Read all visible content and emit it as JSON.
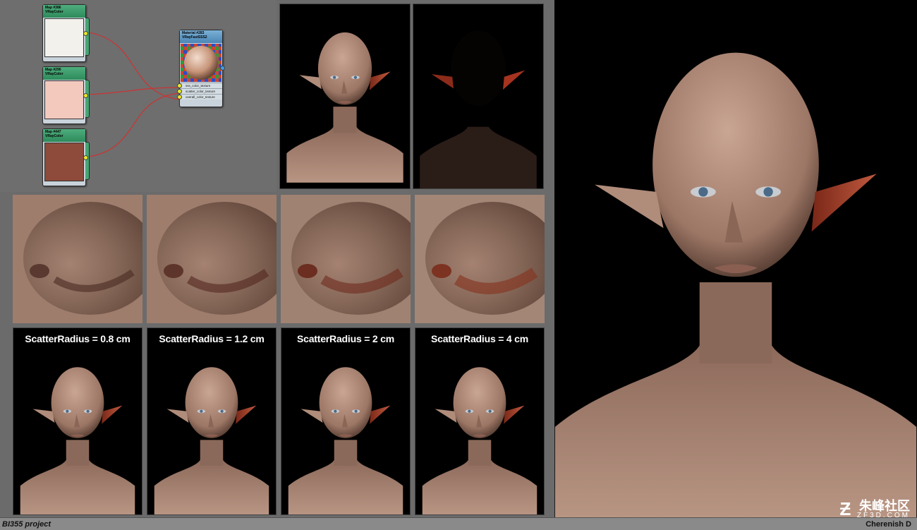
{
  "nodes": {
    "map1": {
      "title": "Map #386",
      "type": "VRayColor",
      "color": "#f2f1ec"
    },
    "map2": {
      "title": "Map #290",
      "type": "VRayColor",
      "color": "#f3c9be"
    },
    "map3": {
      "title": "Map #447",
      "type": "VRayColor",
      "color": "#8e4a3a"
    },
    "material": {
      "title": "Material #283",
      "type": "VRayFastSSS2",
      "slots": [
        "sss_color_texture",
        "scatter_color_texture",
        "overall_color_texture"
      ]
    }
  },
  "captions": [
    "ScatterRadius = 0.8 cm",
    "ScatterRadius = 1.2 cm",
    "ScatterRadius = 2 cm",
    "ScatterRadius = 4 cm"
  ],
  "footer": {
    "left": "BI355 project",
    "right": "Cherenish D"
  },
  "watermark": {
    "main": "朱峰社区",
    "sub": "ZF3D.COM"
  },
  "colors": {
    "skin": "#b89583",
    "ear": "#b5513a",
    "background": "#000000",
    "editor": "#6e6e6e"
  }
}
